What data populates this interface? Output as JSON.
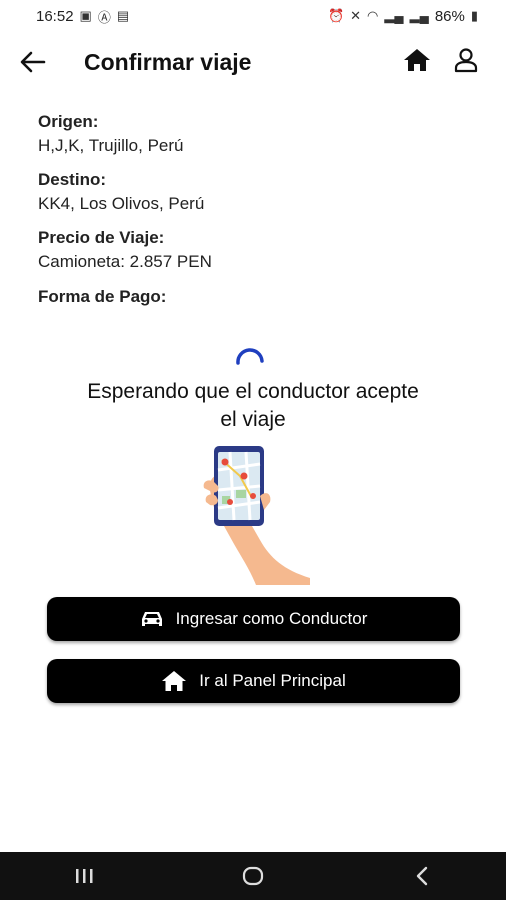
{
  "status": {
    "time": "16:52",
    "battery": "86%",
    "left_icons": [
      "image-icon",
      "a-icon",
      "gps-icon"
    ],
    "right_icons": [
      "alarm-icon",
      "mute-icon",
      "wifi-icon",
      "signal-icon",
      "signal-icon",
      "battery-icon"
    ]
  },
  "header": {
    "title": "Confirmar viaje"
  },
  "trip": {
    "origin_label": "Origen:",
    "origin_value": "H,J,K, Trujillo, Perú",
    "destination_label": "Destino:",
    "destination_value": "KK4, Los Olivos, Perú",
    "price_label": "Precio de Viaje:",
    "price_value": "Camioneta: 2.857 PEN",
    "payment_label": "Forma de Pago:"
  },
  "waiting": {
    "line1": "Esperando que el conductor acepte",
    "line2": "el viaje"
  },
  "buttons": {
    "driver_label": "Ingresar como Conductor",
    "panel_label": "Ir al Panel Principal"
  },
  "colors": {
    "button_bg": "#000000",
    "accent": "#1f3fbf",
    "navbar": "#111111"
  }
}
